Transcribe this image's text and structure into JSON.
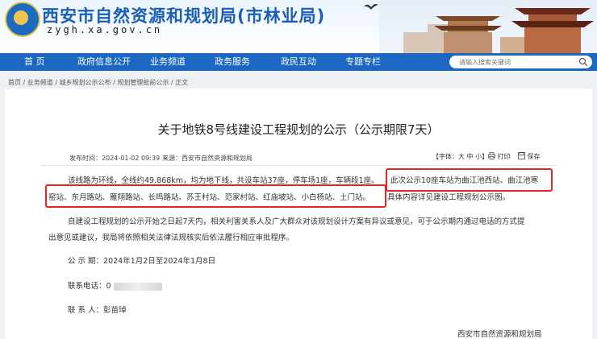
{
  "site": {
    "title": "西安市自然资源和规划局(市林业局)",
    "domain": "zygh.xa.gov.cn",
    "brand_color": "#1c67c2"
  },
  "nav": {
    "items": [
      "首 页",
      "政府信息公开",
      "业务频道",
      "政务服务",
      "政民互动",
      "专题专栏"
    ],
    "search_placeholder": "请输入搜索关键词"
  },
  "breadcrumb": "首页 / 业务频道 / 城乡规划公示公布 / 规划管理批前公示 / 正文",
  "article": {
    "title": "关于地铁8号线建设工程规划的公示（公示期限7天）",
    "publish_time": "发布时间：2024-01-02 09:39",
    "source": "来源：西安市自然资源和规划局",
    "font_size_label": "【字体：大 中 小】",
    "print_label": "打印",
    "save_label": "保存",
    "para1_line1_a": "该线路为环线，全线约49.868km，均为地下线，共设车站37座，停车场1座，车辆段1座。",
    "para1_line1_b": "此次公示10座车站为曲江池西站、曲江池寒",
    "para1_line2_a": "窑站、东月路站、雁翔路站、长鸣路站、苏王村站、范家村站、红庙坡站、小白杨站、土门站。",
    "para1_line2_b": "具体内容详见建设工程规划公示图。",
    "para2_line1": "自建设工程规划的公示开始之日起7天内，相关利害关系人及广大群众对该规划设计方案有异议或意见，可于公示期内通过电话的方式提",
    "para2_line2": "出意见或建议，我局将依照相关法律法规核实后依法履行相应审批程序。",
    "period": "公 示 期：2024年1月2日至2024年1月8日",
    "phone_label": "联系电话：0",
    "contact": "联 系 人：彭苗琸",
    "signature": "西安市自然资源和规划局",
    "highlight_color": "#e62424"
  }
}
